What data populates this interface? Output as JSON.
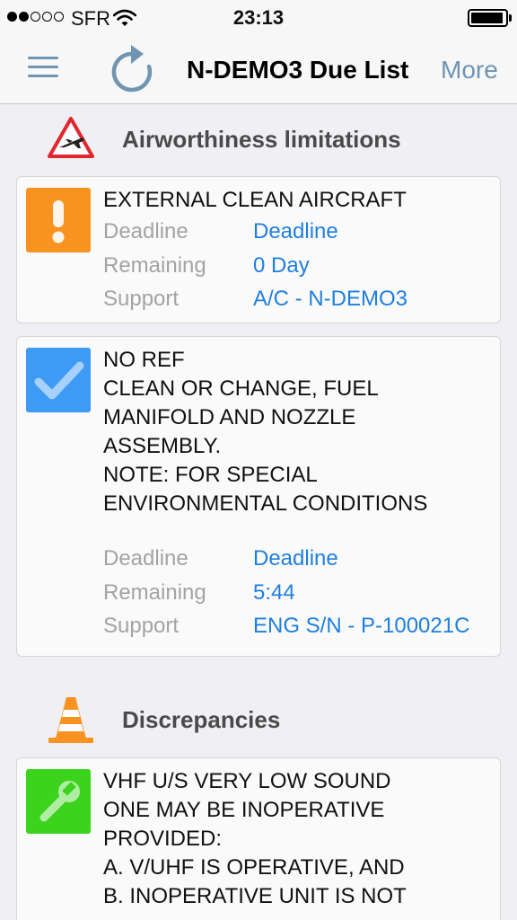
{
  "status_bar": {
    "carrier": "SFR",
    "time": "23:13",
    "signal_strength": 2,
    "battery_level": 0.95
  },
  "nav": {
    "title": "N-DEMO3 Due List",
    "more_label": "More",
    "accent_color": "#6f95b3"
  },
  "sections": [
    {
      "title": "Airworthiness limitations",
      "icon": "airplane-warning-icon",
      "cards": [
        {
          "status_icon": "exclamation-icon",
          "status_color": "#f7931e",
          "title": "EXTERNAL CLEAN AIRCRAFT",
          "fields": [
            {
              "label": "Deadline",
              "value": "Deadline"
            },
            {
              "label": "Remaining",
              "value": "0 Day"
            },
            {
              "label": "Support",
              "value": "A/C - N-DEMO3"
            }
          ]
        },
        {
          "status_icon": "checkmark-icon",
          "status_color": "#3d9af5",
          "title": "NO REF\nCLEAN OR CHANGE, FUEL\nMANIFOLD AND NOZZLE\nASSEMBLY.\nNOTE: FOR SPECIAL\nENVIRONMENTAL CONDITIONS",
          "fields": [
            {
              "label": "Deadline",
              "value": "Deadline"
            },
            {
              "label": "Remaining",
              "value": "5:44"
            },
            {
              "label": "Support",
              "value": "ENG S/N - P-100021C"
            }
          ]
        }
      ]
    },
    {
      "title": "Discrepancies",
      "icon": "traffic-cone-icon",
      "cards": [
        {
          "status_icon": "wrench-icon",
          "status_color": "#3bd31b",
          "title": "VHF U/S VERY LOW SOUND\nONE MAY BE INOPERATIVE\nPROVIDED:\nA.    V/UHF IS OPERATIVE, AND\nB.    INOPERATIVE UNIT IS NOT"
        }
      ]
    }
  ]
}
